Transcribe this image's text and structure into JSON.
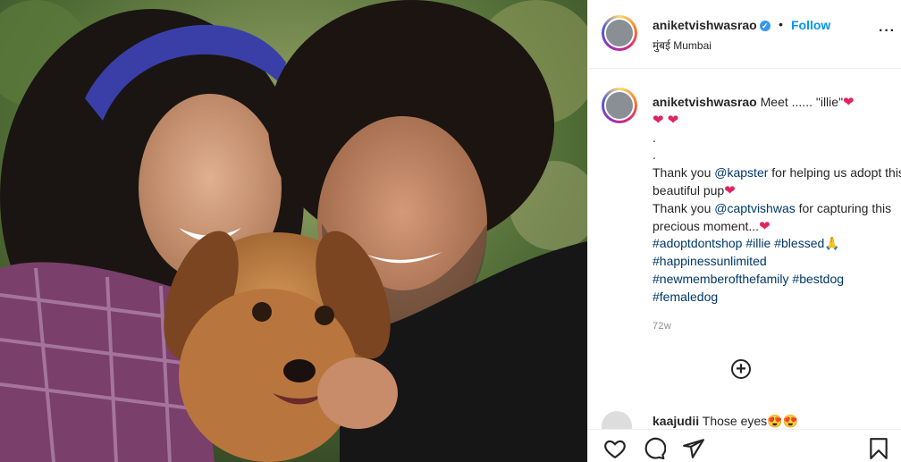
{
  "photo": {
    "alt": "",
    "watermark": ""
  },
  "post": {
    "username": "aniketvishwasrao",
    "verified_mark": "✓",
    "separator": "•",
    "follow_label": "Follow",
    "location": "मुंबई Mumbai",
    "more_label": "···"
  },
  "caption": {
    "username": "aniketvishwasrao",
    "line1": " Meet ...... \"illie\"",
    "hearts": "❤ ❤",
    "dot1": ".",
    "dot2": ".",
    "thank1_a": "Thank you ",
    "mention1": "@kapster",
    "thank1_b": " for helping us adopt this beautiful pup",
    "thank2_a": "Thank you ",
    "mention2": "@captvishwas",
    "thank2_b": " for capturing this precious moment...",
    "heart_single": "❤",
    "tag1": "#adoptdontshop",
    "tag2": "#illie",
    "tag3": "#blessed",
    "pray": "🙏",
    "tag4": "#happinessunlimited",
    "tag5": "#newmemberofthefamily",
    "tag6": "#bestdog",
    "tag7": "#femaledog",
    "time": "72w"
  },
  "load_more_icon": "+",
  "comment": {
    "username": "kaajudii",
    "text": " Those eyes",
    "emoji": "😍😍"
  },
  "actions": {
    "like": "heart-outline-icon",
    "comment": "comment-bubble-icon",
    "share": "paper-plane-icon",
    "save": "bookmark-icon"
  },
  "colors": {
    "link": "#00376b",
    "follow": "#0095f6",
    "heart": "#e0245e",
    "meta": "#8e8e8e"
  }
}
